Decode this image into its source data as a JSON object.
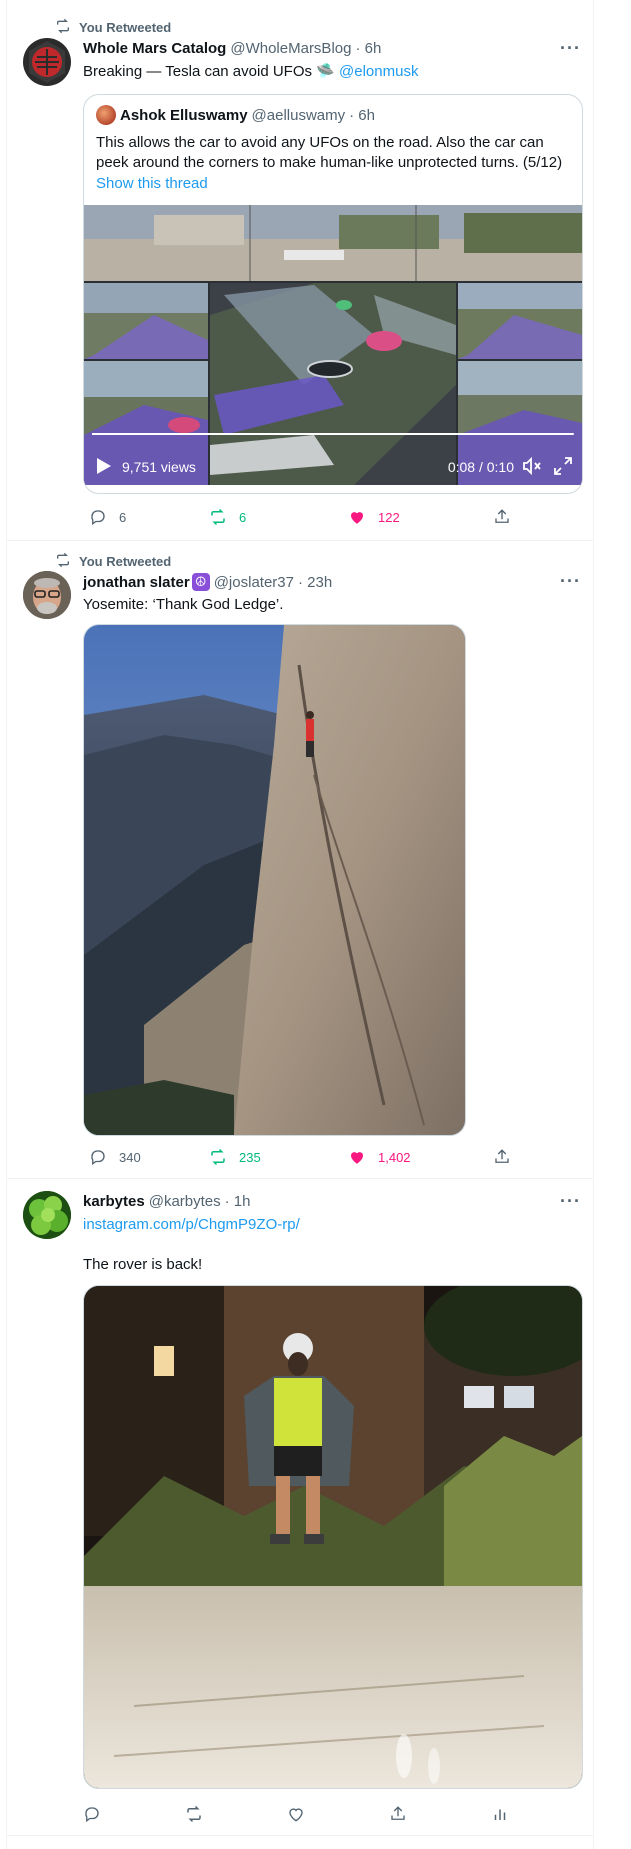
{
  "tweets": [
    {
      "retweet_context": "You Retweeted",
      "name": "Whole Mars Catalog",
      "handle": "@WholeMarsBlog",
      "time": "· 6h",
      "text": "Breaking — Tesla can avoid UFOs",
      "emoji": "🛸",
      "mention": "@elonmusk",
      "quote": {
        "name": "Ashok Elluswamy",
        "handle": "@aelluswamy",
        "time": "· 6h",
        "text": "This allows the car to avoid any UFOs on the road. Also the car can peek around the corners to make human-like unprotected turns. (5/12)",
        "show_thread": "Show this thread",
        "video": {
          "views": "9,751 views",
          "time": "0:08 / 0:10",
          "progress": 0.8
        }
      },
      "actions": {
        "replies": "6",
        "retweets": "6",
        "likes": "122"
      }
    },
    {
      "retweet_context": "You Retweeted",
      "name": "jonathan slater",
      "badge": "☮",
      "handle": "@joslater37",
      "time": "· 23h",
      "text": "Yosemite: ‘Thank God Ledge’.",
      "actions": {
        "replies": "340",
        "retweets": "235",
        "likes": "1,402"
      }
    },
    {
      "name": "karbytes",
      "handle": "@karbytes",
      "time": "· 1h",
      "link": "instagram.com/p/ChgmP9ZO-rp/",
      "text": "The rover is back!"
    }
  ],
  "colors": {
    "accent": "#1d9bf0",
    "retweet": "#00ba7c",
    "like": "#f91880",
    "muted": "#536471"
  }
}
